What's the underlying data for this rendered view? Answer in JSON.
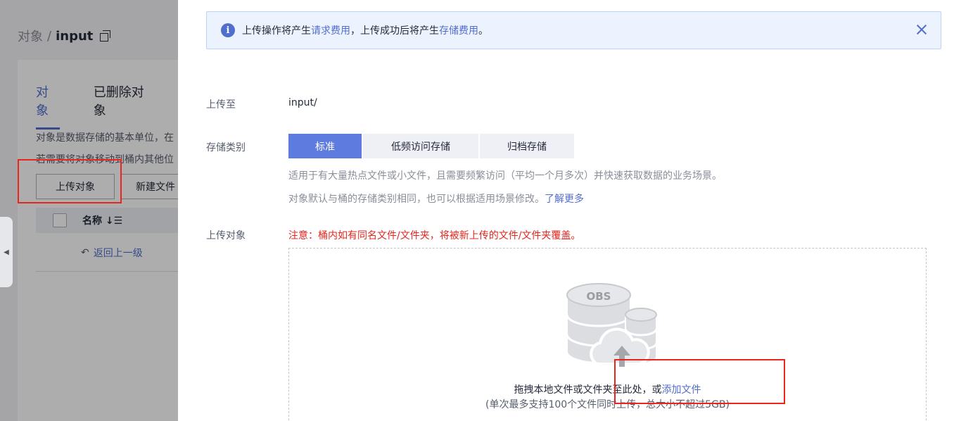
{
  "background": {
    "breadcrumb": {
      "parent": "对象",
      "separator": "/",
      "current": "input"
    },
    "tabs": [
      "对象",
      "已删除对象"
    ],
    "desc_line1": "对象是数据存储的基本单位，在",
    "desc_line2": "若需要将对象移动到桶内其他位",
    "buttons": {
      "upload": "上传对象",
      "new_folder": "新建文件"
    },
    "table": {
      "col_name": "名称 ↓☰"
    },
    "back_link": "返回上一级"
  },
  "alert": {
    "text_a": "上传操作将产生",
    "link_a": "请求费用",
    "text_b": "，上传成功后将产生",
    "link_b": "存储费用",
    "text_c": "。"
  },
  "form": {
    "upload_to_label": "上传至",
    "upload_to_value": "input/",
    "storage_class_label": "存储类别",
    "storage_classes": [
      "标准",
      "低频访问存储",
      "归档存储"
    ],
    "selected_storage_class": "标准",
    "hint1": "适用于有大量热点文件或小文件，且需要频繁访问（平均一个月多次）并快速获取数据的业务场景。",
    "hint2_text": "对象默认与桶的存储类别相同，也可以根据适用场景修改。",
    "hint2_link": "了解更多",
    "upload_object_label": "上传对象",
    "warning": "注意：桶内如有同名文件/文件夹，将被新上传的文件/文件夹覆盖。"
  },
  "dropzone": {
    "icon_label": "OBS",
    "text": "拖拽本地文件或文件夹至此处，或",
    "link": "添加文件",
    "sub": "(单次最多支持100个文件同时上传，总大小不超过5GB)"
  },
  "colors": {
    "accent": "#526ecc",
    "selected": "#5e7ce0",
    "warning": "#e6261f"
  }
}
